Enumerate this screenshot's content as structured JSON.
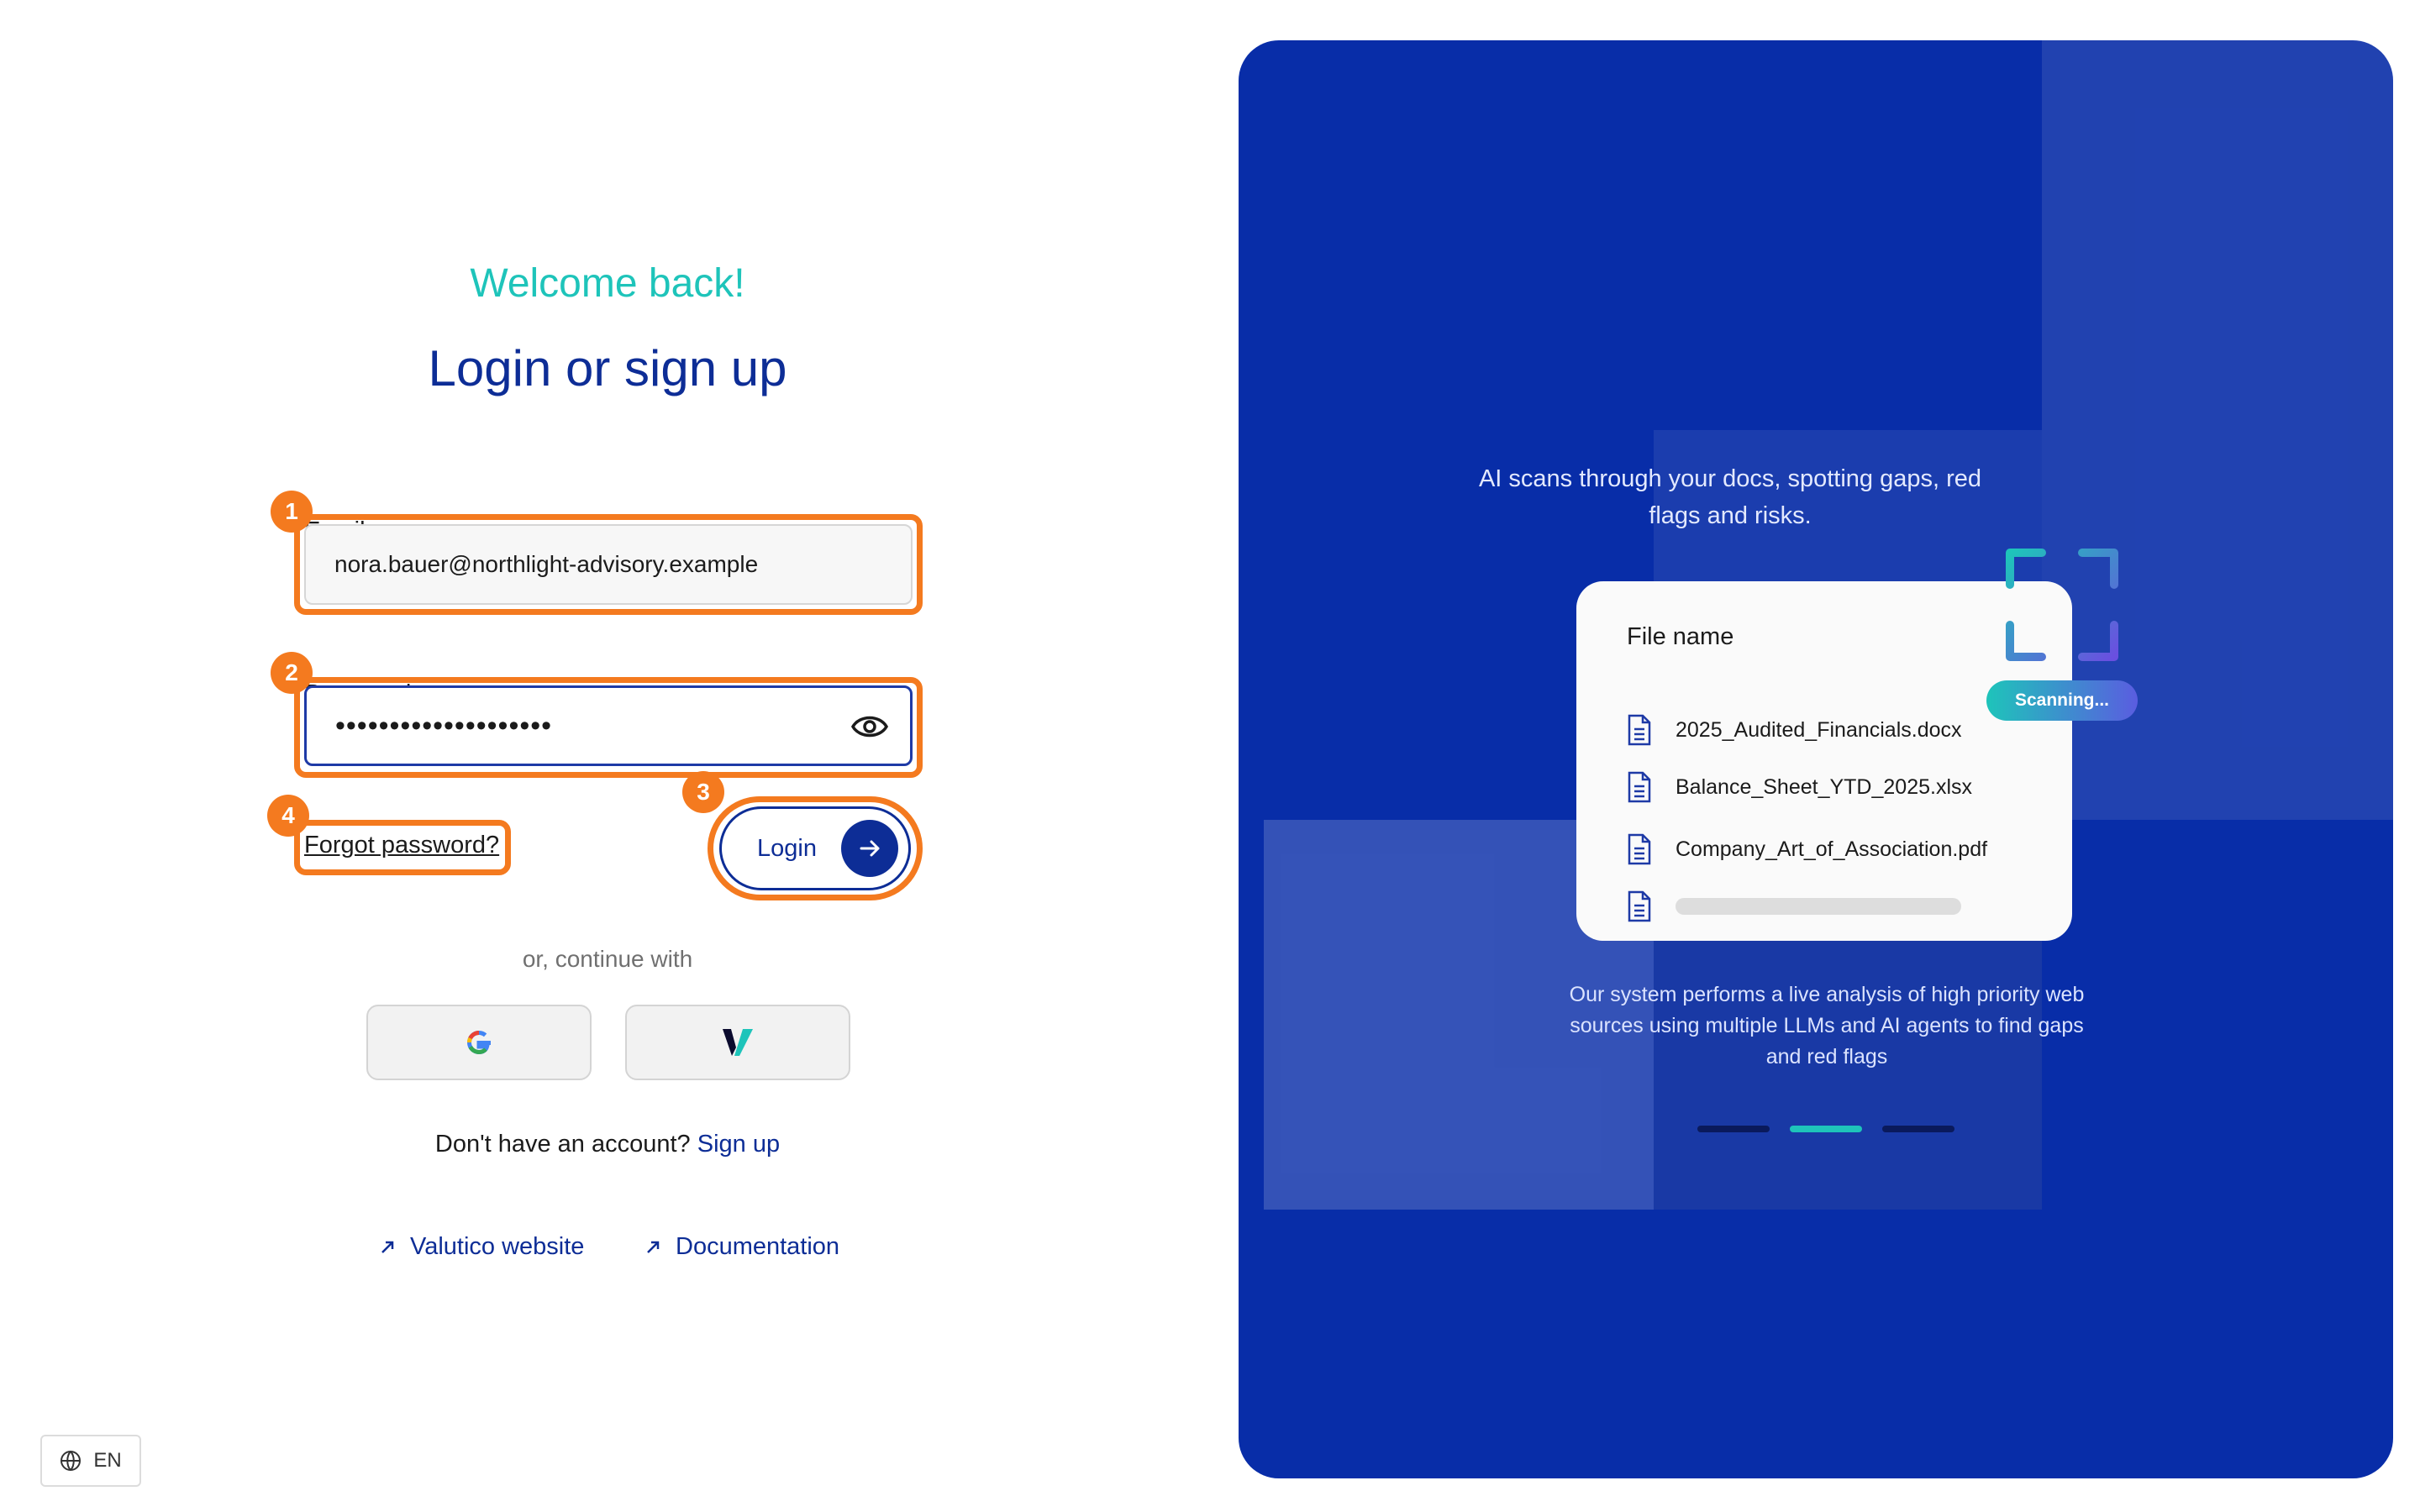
{
  "login": {
    "welcome": "Welcome back!",
    "heading": "Login or sign up",
    "email_label": "Email",
    "email_value": "nora.bauer@northlight-advisory.example",
    "password_label": "Password",
    "password_mask": "••••••••••••••••••••",
    "forgot_password": "Forgot password?",
    "login_button": "Login",
    "or_continue": "or, continue with",
    "no_account": "Don't have an account?",
    "sign_up": "Sign up",
    "links": {
      "website": "Valutico website",
      "documentation": "Documentation"
    },
    "language": "EN"
  },
  "badges": {
    "one": "1",
    "two": "2",
    "three": "3",
    "four": "4"
  },
  "panel": {
    "tagline": "AI scans through your docs, spotting gaps, red flags and risks.",
    "card_title": "File name",
    "files": [
      "2025_Audited_Financials.docx",
      "Balance_Sheet_YTD_2025.xlsx",
      "Company_Art_of_Association.pdf"
    ],
    "scanning": "Scanning...",
    "description": "Our system performs a live analysis of high priority web sources using multiple LLMs and AI agents to find gaps and red flags",
    "carousel_active_index": 1
  },
  "colors": {
    "accent_teal": "#1ec4ba",
    "brand_blue": "#0d2d96",
    "panel_blue": "#082da8",
    "highlight_orange": "#f47a1f"
  }
}
